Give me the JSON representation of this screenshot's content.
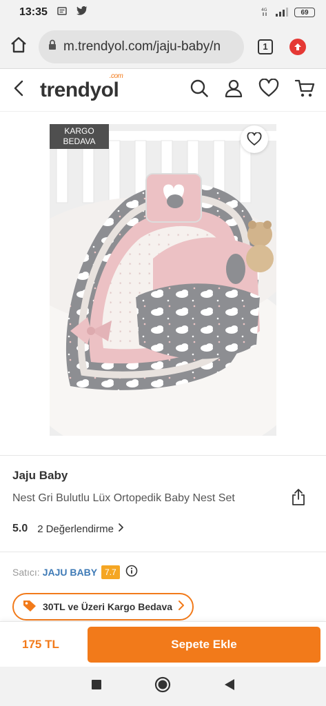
{
  "status_bar": {
    "time": "13:35",
    "battery": "69",
    "left_icons": [
      "message-icon",
      "twitter-icon"
    ],
    "right_icons": [
      "network-icon",
      "signal-icon",
      "battery-icon"
    ]
  },
  "browser": {
    "url": "m.trendyol.com/jaju-baby/n",
    "tab_count": "1",
    "icons": [
      "home-icon",
      "lock-icon",
      "update-icon"
    ]
  },
  "site_header": {
    "logo_text": "trendyol",
    "logo_suffix": ".com",
    "icons": [
      "back-icon",
      "search-icon",
      "account-icon",
      "favorites-icon",
      "cart-icon"
    ]
  },
  "product_image": {
    "badge": "KARGO BEDAVA",
    "icons": [
      "heart-icon"
    ]
  },
  "product": {
    "brand": "Jaju Baby",
    "name": "Nest Gri Bulutlu Lüx Ortopedik Baby Nest Set",
    "rating": "5.0",
    "stars": 5,
    "review_count": "2",
    "review_label": "Değerlendirme",
    "icons": [
      "share-icon",
      "star-icon",
      "chevron-right-icon"
    ]
  },
  "seller": {
    "label": "Satıcı:",
    "name": "JAJU BABY",
    "score": "7.7",
    "icons": [
      "info-icon"
    ]
  },
  "shipping_promo": {
    "text": "30TL ve Üzeri Kargo Bedava",
    "icons": [
      "tag-icon",
      "chevron-right-icon"
    ]
  },
  "action_bar": {
    "price": "175 TL",
    "add_to_cart": "Sepete Ekle"
  },
  "system_nav": {
    "icons": [
      "recents-icon",
      "home-circle-icon",
      "back-triangle-icon"
    ]
  },
  "colors": {
    "brand_orange": "#f27a1a",
    "star_yellow": "#ffc000",
    "seller_blue": "#3e7ab6",
    "badge_gray": "#4f4f4f"
  }
}
